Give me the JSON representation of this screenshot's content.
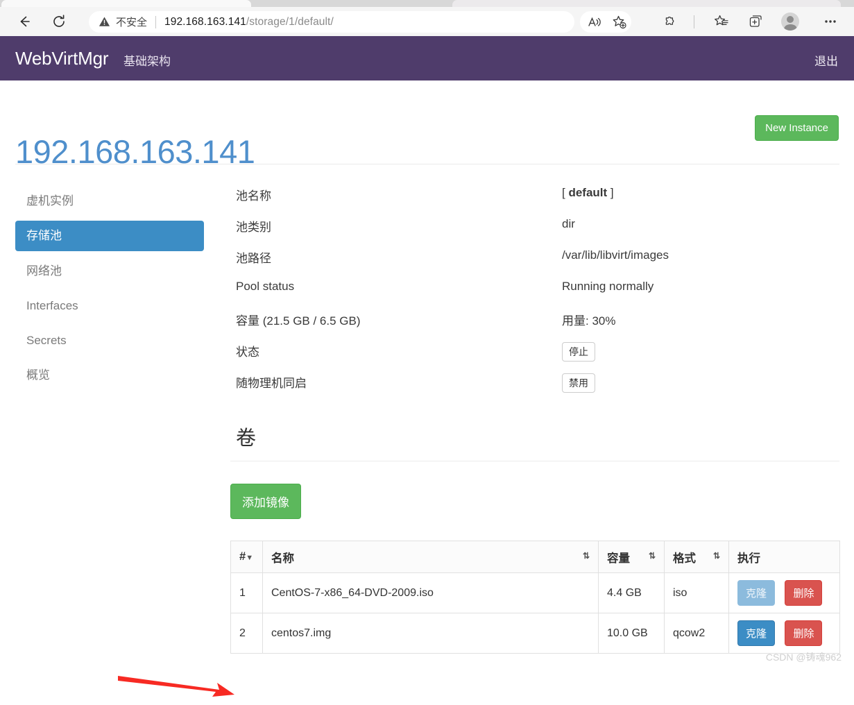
{
  "browser": {
    "back_icon": "back-arrow-icon",
    "reload_icon": "reload-icon",
    "security": {
      "icon": "warning-triangle-icon",
      "label": "不安全"
    },
    "url": {
      "host": "192.168.163.141",
      "path": "/storage/1/default/",
      "full": "192.168.163.141/storage/1/default/"
    },
    "toolbar_icons": [
      "read-aloud-icon",
      "add-favorite-icon",
      "extensions-puzzle-icon",
      "favorites-star-icon",
      "collections-icon",
      "profile-avatar-icon",
      "more-options-icon"
    ]
  },
  "navbar": {
    "brand": "WebVirtMgr",
    "infra_label": "基础架构",
    "logout_label": "退出",
    "background": "#4f3c6b"
  },
  "header": {
    "title": "192.168.163.141",
    "title_color": "#4f8fcc",
    "new_instance_label": "New Instance",
    "new_instance_color": "#5cb85c"
  },
  "sidebar": {
    "items": [
      {
        "label": "虚机实例",
        "active": false
      },
      {
        "label": "存储池",
        "active": true
      },
      {
        "label": "网络池",
        "active": false
      },
      {
        "label": "Interfaces",
        "active": false
      },
      {
        "label": "Secrets",
        "active": false
      },
      {
        "label": "概览",
        "active": false
      }
    ],
    "active_color": "#3c8dc5"
  },
  "pool_details": {
    "rows": [
      {
        "label": "池名称",
        "value_prefix": "[ ",
        "value_bold": "default",
        "value_suffix": " ]",
        "type": "rich"
      },
      {
        "label": "池类别",
        "value": "dir",
        "type": "text"
      },
      {
        "label": "池路径",
        "value": "/var/lib/libvirt/images",
        "type": "text"
      },
      {
        "label": "Pool status",
        "value": "Running normally",
        "type": "text"
      },
      {
        "label": "容量 (21.5 GB / 6.5 GB)",
        "value": "用量: 30%",
        "type": "text"
      },
      {
        "label": "状态",
        "value": "停止",
        "type": "button"
      },
      {
        "label": "随物理机同启",
        "value": "禁用",
        "type": "button"
      }
    ],
    "capacity_total": "21.5 GB",
    "capacity_used": "6.5 GB",
    "usage_percent": 30
  },
  "volumes": {
    "heading": "卷",
    "add_image_label": "添加镜像",
    "columns": [
      {
        "label": "#",
        "sortable": true,
        "caret": "▼"
      },
      {
        "label": "名称",
        "sortable": true,
        "caret": "⇅"
      },
      {
        "label": "容量",
        "sortable": true,
        "caret": "⇅"
      },
      {
        "label": "格式",
        "sortable": true,
        "caret": "⇅"
      },
      {
        "label": "执行",
        "sortable": false,
        "caret": ""
      }
    ],
    "rows": [
      {
        "index": "1",
        "name": "CentOS-7-x86_64-DVD-2009.iso",
        "size": "4.4 GB",
        "format": "iso",
        "clone_label": "克隆",
        "delete_label": "删除",
        "clone_faded": true
      },
      {
        "index": "2",
        "name": "centos7.img",
        "size": "10.0 GB",
        "format": "qcow2",
        "clone_label": "克隆",
        "delete_label": "删除",
        "clone_faded": false
      }
    ],
    "clone_color": "#3c8dc5",
    "delete_color": "#d9534f"
  },
  "annotation": {
    "type": "arrow",
    "color": "#f72a23",
    "points_to": "volume-row-2"
  },
  "watermark": "CSDN @铸魂962"
}
